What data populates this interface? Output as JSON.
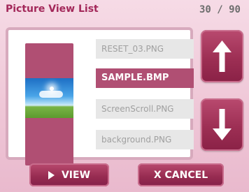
{
  "header": {
    "title": "Picture View List",
    "counter": "30 / 90"
  },
  "files": [
    {
      "name": "RESET_03.PNG",
      "selected": false
    },
    {
      "name": "SAMPLE.BMP",
      "selected": true
    },
    {
      "name": "ScreenScroll.PNG",
      "selected": false
    },
    {
      "name": "background.PNG",
      "selected": false
    }
  ],
  "scroll": {
    "up_icon": "arrow-up-icon",
    "down_icon": "arrow-down-icon"
  },
  "actions": {
    "view_label": "VIEW",
    "view_icon": "play-icon",
    "cancel_label": "X CANCEL"
  },
  "colors": {
    "accent": "#b04f73",
    "title": "#a3285a",
    "background": "#f2d1df",
    "item_bg": "#e7e7e7",
    "item_text": "#a0a0a0"
  }
}
